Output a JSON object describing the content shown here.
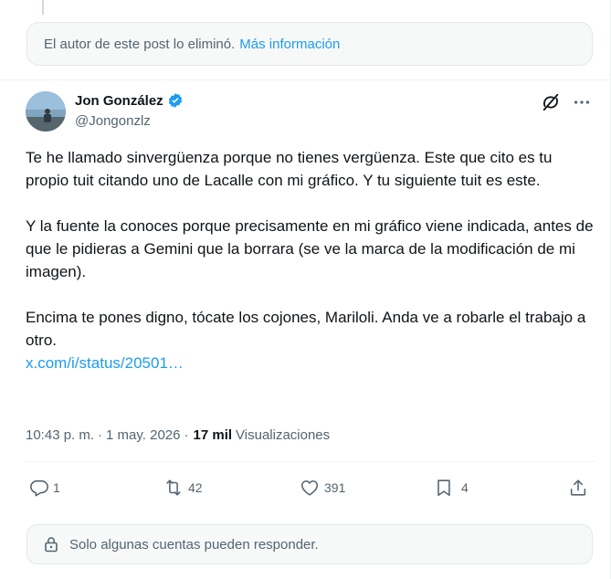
{
  "deleted_notice": {
    "text": "El autor de este post lo eliminó.",
    "link": "Más información"
  },
  "author": {
    "name": "Jon González",
    "handle": "@Jongonzlz",
    "verified": true
  },
  "tweet": {
    "paragraphs": [
      "Te he llamado sinvergüenza porque no tienes vergüenza. Este que cito es tu propio tuit citando uno de Lacalle con mi gráfico. Y tu siguiente tuit es este.",
      "Y la fuente la conoces porque precisamente en mi gráfico viene indicada, antes de que le pidieras a Gemini que la borrara (se ve la marca de la modificación de mi imagen).",
      "Encima te pones digno, tócate los cojones, Mariloli. Anda ve a robarle el trabajo a otro."
    ],
    "link": "x.com/i/status/20501…"
  },
  "meta": {
    "time": "10:43 p. m.",
    "separator": "·",
    "date": "1 may. 2026",
    "views_count": "17 mil",
    "views_label": "Visualizaciones"
  },
  "actions": {
    "replies": "1",
    "reposts": "42",
    "likes": "391",
    "bookmarks": "4"
  },
  "reply_restriction": "Solo algunas cuentas pueden responder.",
  "colors": {
    "link": "#1d9bf0",
    "secondary": "#536471",
    "verified": "#1d9bf0"
  }
}
